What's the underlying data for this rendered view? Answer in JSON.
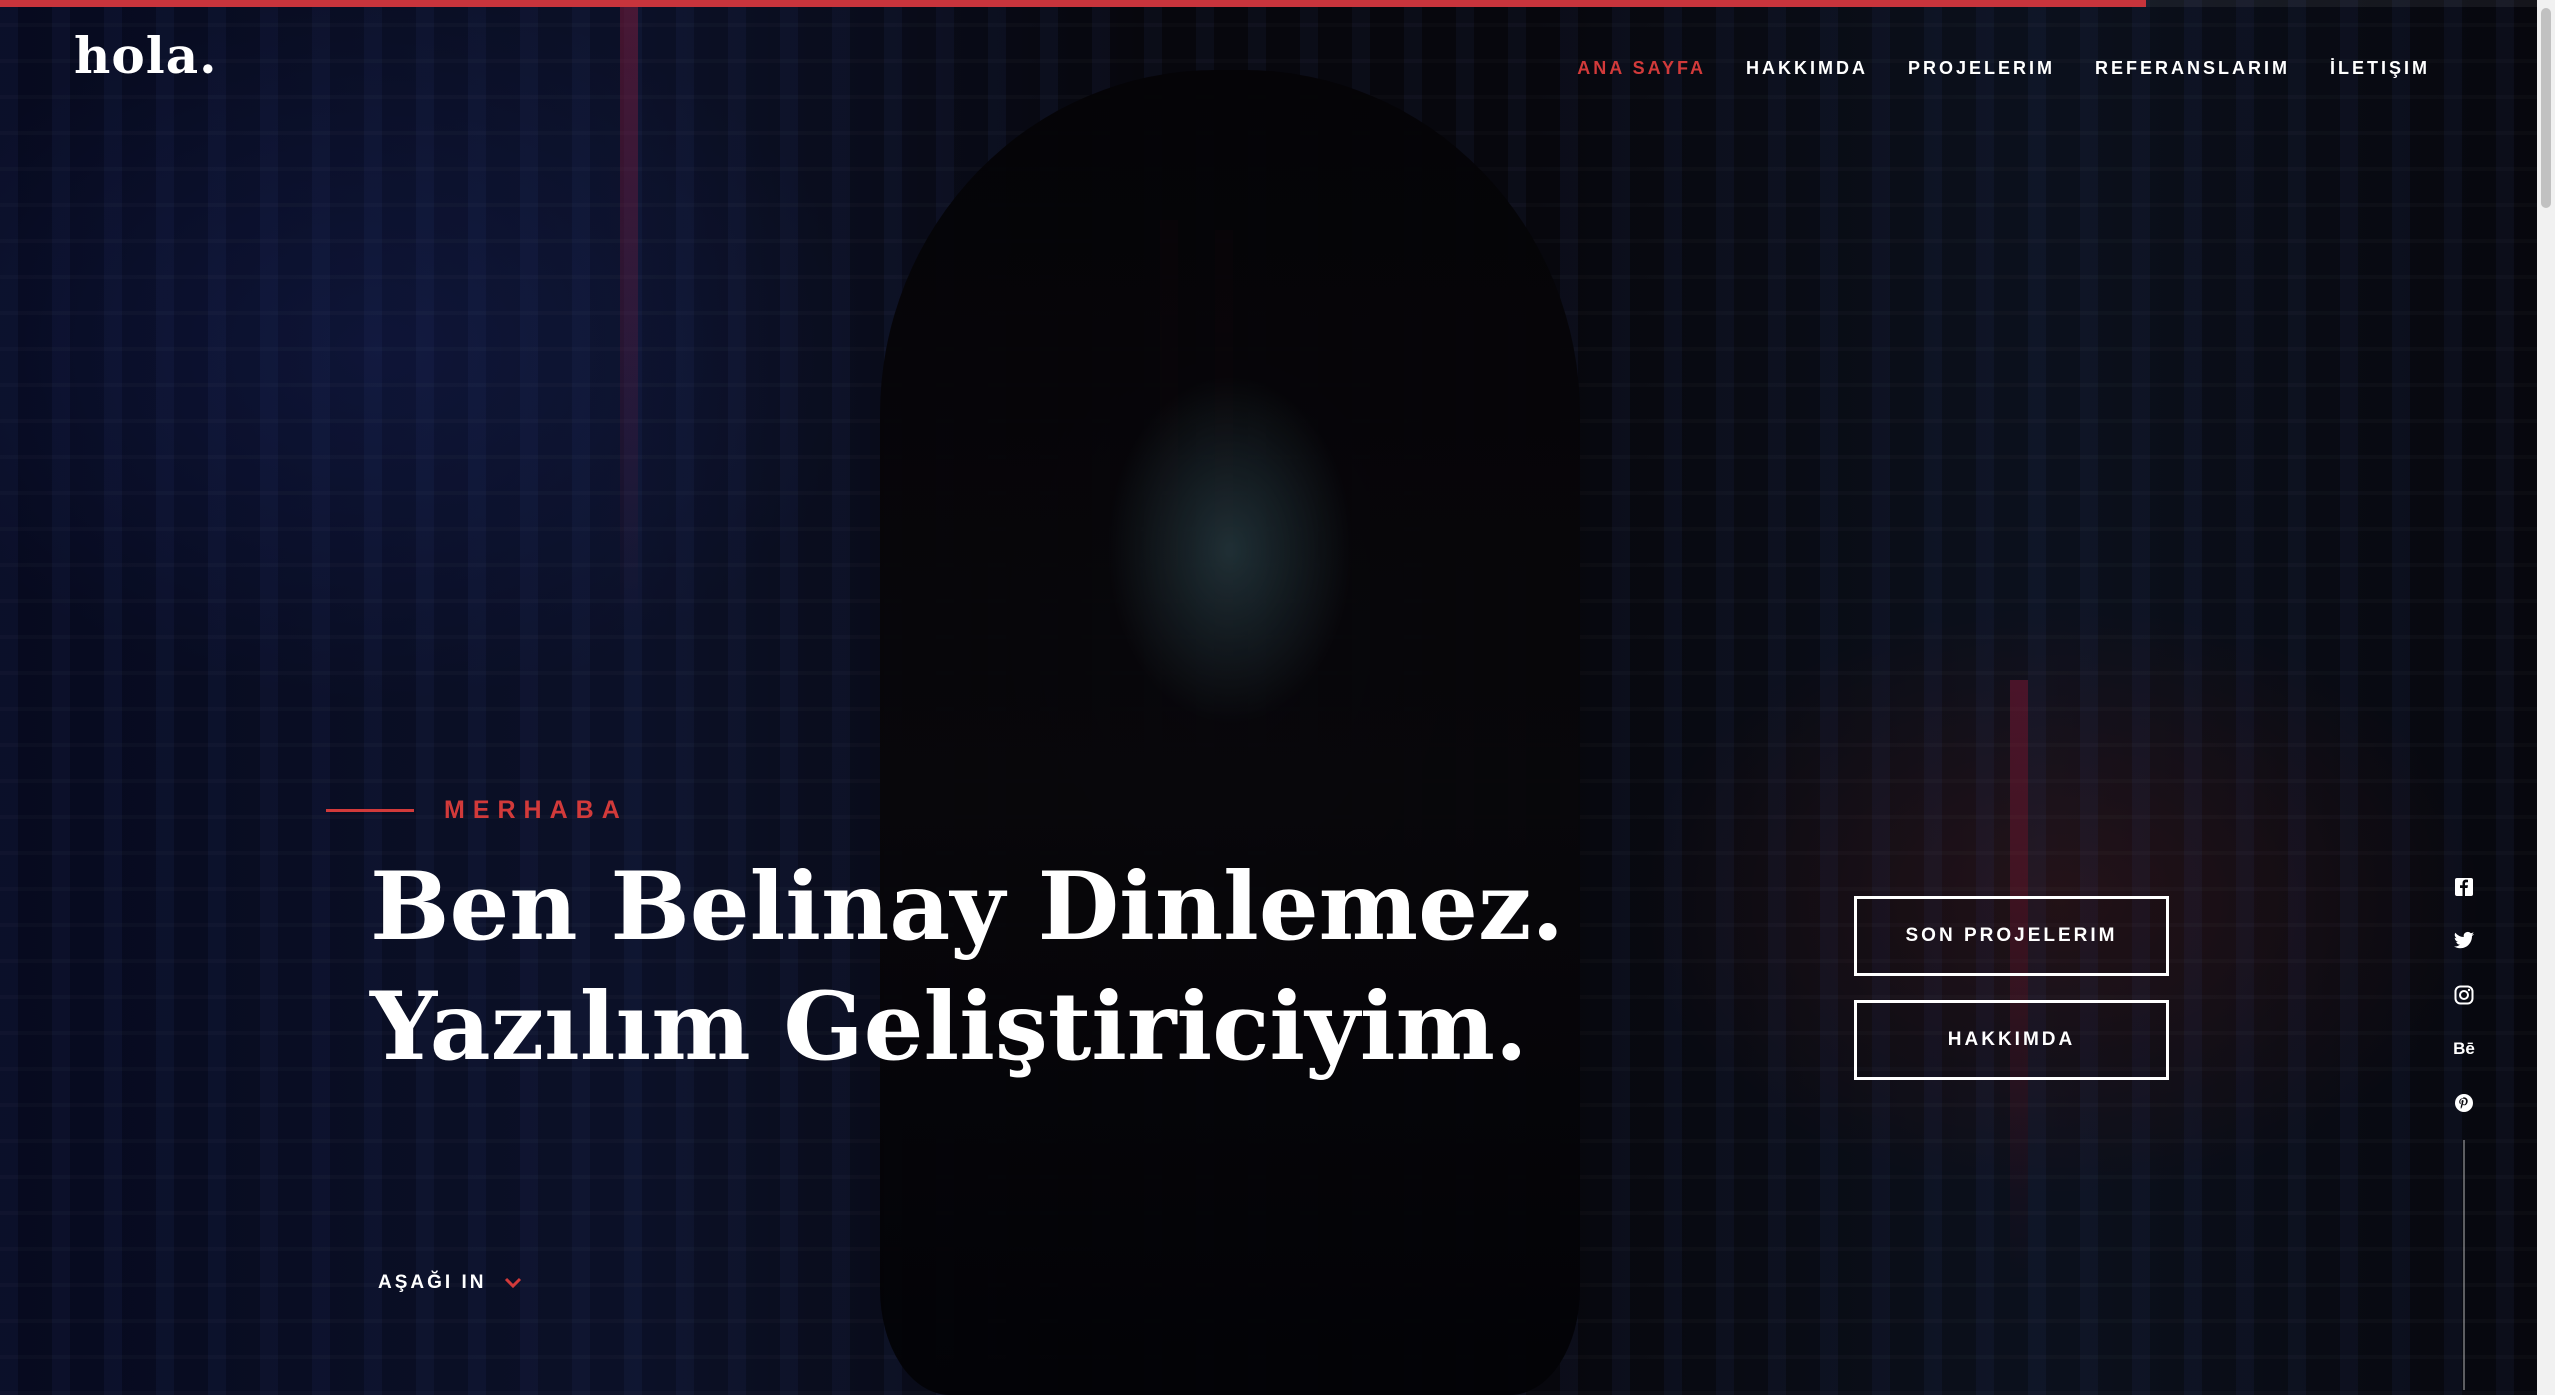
{
  "header": {
    "logo": "hola.",
    "progress_percent": 84,
    "nav": [
      {
        "label": "ANA SAYFA",
        "active": true
      },
      {
        "label": "HAKKIMDA",
        "active": false
      },
      {
        "label": "PROJELERIM",
        "active": false
      },
      {
        "label": "REFERANSLARIM",
        "active": false
      },
      {
        "label": "İLETIŞIM",
        "active": false
      }
    ]
  },
  "hero": {
    "greeting": "MERHABA",
    "title_line1": "Ben Belinay Dinlemez.",
    "title_line2": "Yazılım Geliştiriciyim.",
    "buttons": {
      "projects": "SON PROJELERIM",
      "about": "HAKKIMDA"
    },
    "scroll_down": "AŞAĞI IN"
  },
  "social": {
    "behance": "Bē"
  },
  "colors": {
    "accent": "#d23a3a",
    "text": "#ffffff"
  }
}
